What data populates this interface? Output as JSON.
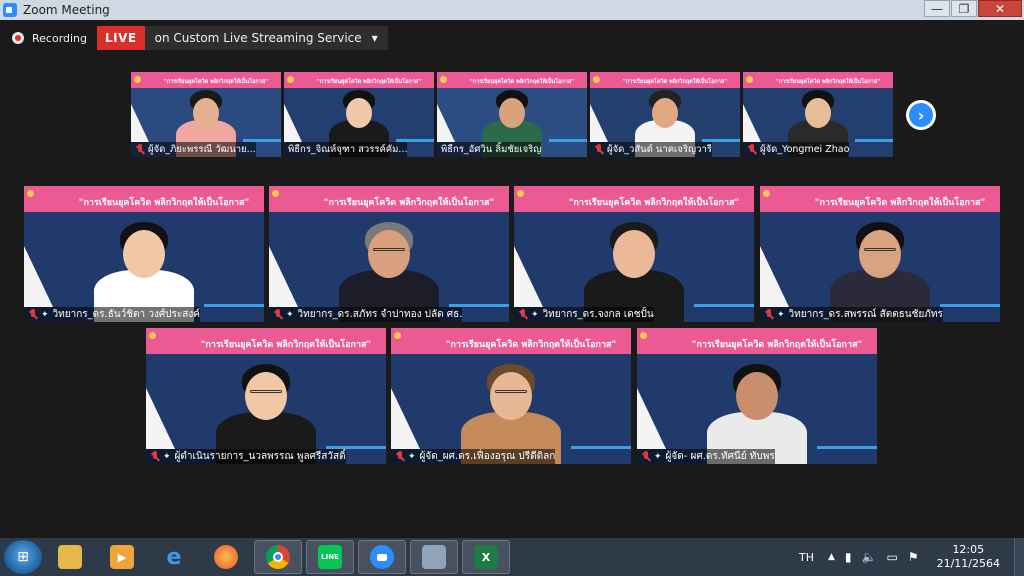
{
  "window": {
    "title": "Zoom Meeting",
    "controls": {
      "minimize": "—",
      "maximize": "❐",
      "close": "✕"
    }
  },
  "recording": {
    "label": "Recording",
    "live_badge": "LIVE",
    "stream_label": "on Custom Live Streaming Service",
    "stream_chevron": "▼"
  },
  "banner": {
    "title": "\"การเรียนยุคโควิด พลิกวิกฤตให้เป็นโอกาส\"",
    "colors": {
      "pink": "#ec5a93",
      "tile_bg": "#1f3a6b"
    }
  },
  "participants_top": [
    {
      "name": "ผู้จัด_ภิยะพรรณี วัฒนาย...",
      "muted": true
    },
    {
      "name": "พิธีกร_จิณห์จุฑา สวรรค์คัม...",
      "muted": false
    },
    {
      "name": "พิธีกร_อัศวิน ลิ้มชัยเจริญ",
      "muted": false
    },
    {
      "name": "ผู้จัด_วสันต์ นาคเจริญวารี",
      "muted": true
    },
    {
      "name": "ผู้จัด_Yongmei Zhao",
      "muted": true
    }
  ],
  "participants_main": [
    {
      "name": "วิทยากร_ดร.ธันว์ชิตา วงศ์ประสงค์",
      "muted": true
    },
    {
      "name": "วิทยากร_ดร.สภัทร จำปาทอง ปลัด ศธ.",
      "muted": true
    },
    {
      "name": "วิทยากร_ดร.จงกล เดชปั้น",
      "muted": true
    },
    {
      "name": "วิทยากร_ดร.สพรรณ์ สัตตธนชัยภัทร",
      "muted": true
    },
    {
      "name": "ผู้ดำเนินรายการ_นวลพรรณ พูลศรีสวัสดิ์",
      "muted": true
    },
    {
      "name": "ผู้จัด_ผศ.ดร.เฟื่องอรุณ ปรีดีดิลก",
      "muted": true
    },
    {
      "name": "ผู้จัด- ผศ.ดร.ทัศนีย์ ทับพร",
      "muted": true
    }
  ],
  "next_page_icon": "›",
  "taskbar": {
    "apps": [
      "explorer",
      "media-player",
      "internet-explorer",
      "firefox",
      "chrome",
      "line",
      "zoom",
      "calculator",
      "excel"
    ],
    "line_label": "LINE",
    "lang": "TH",
    "time": "12:05",
    "date": "21/11/2564"
  }
}
